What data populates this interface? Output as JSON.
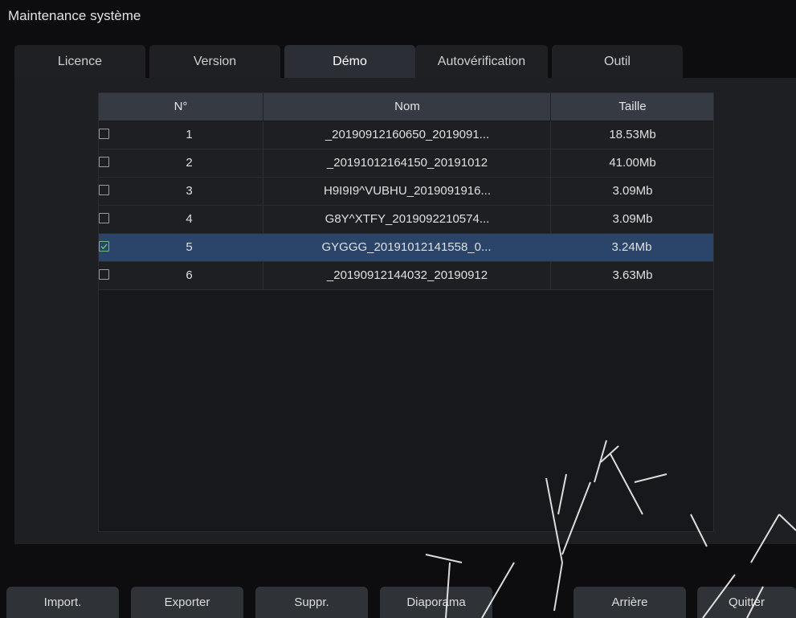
{
  "window": {
    "title": "Maintenance système"
  },
  "tabs": [
    {
      "label": "Licence",
      "active": false
    },
    {
      "label": "Version",
      "active": false
    },
    {
      "label": "Démo",
      "active": true
    },
    {
      "label": "Autovérification",
      "active": false
    },
    {
      "label": "Outil",
      "active": false
    }
  ],
  "table": {
    "columns": {
      "number": "N°",
      "name": "Nom",
      "size": "Taille"
    },
    "rows": [
      {
        "checked": false,
        "number": "1",
        "name": "_20190912160650_2019091...",
        "size": "18.53Mb"
      },
      {
        "checked": false,
        "number": "2",
        "name": "_20191012164150_20191012",
        "size": "41.00Mb"
      },
      {
        "checked": false,
        "number": "3",
        "name": "H9I9I9^VUBHU_2019091916...",
        "size": "3.09Mb"
      },
      {
        "checked": false,
        "number": "4",
        "name": "G8Y^XTFY_2019092210574...",
        "size": "3.09Mb"
      },
      {
        "checked": true,
        "number": "5",
        "name": "GYGGG_20191012141558_0...",
        "size": "3.24Mb"
      },
      {
        "checked": false,
        "number": "6",
        "name": "_20190912144032_20190912",
        "size": "3.63Mb"
      }
    ]
  },
  "buttons": {
    "import": "Import.",
    "export": "Exporter",
    "delete": "Suppr.",
    "slideshow": "Diaporama",
    "back": "Arrière",
    "quit": "Quitter"
  },
  "colors": {
    "selected_row": "#2b4469",
    "checkbox_checked": "#6fbf79",
    "header_bg": "#363a42"
  }
}
